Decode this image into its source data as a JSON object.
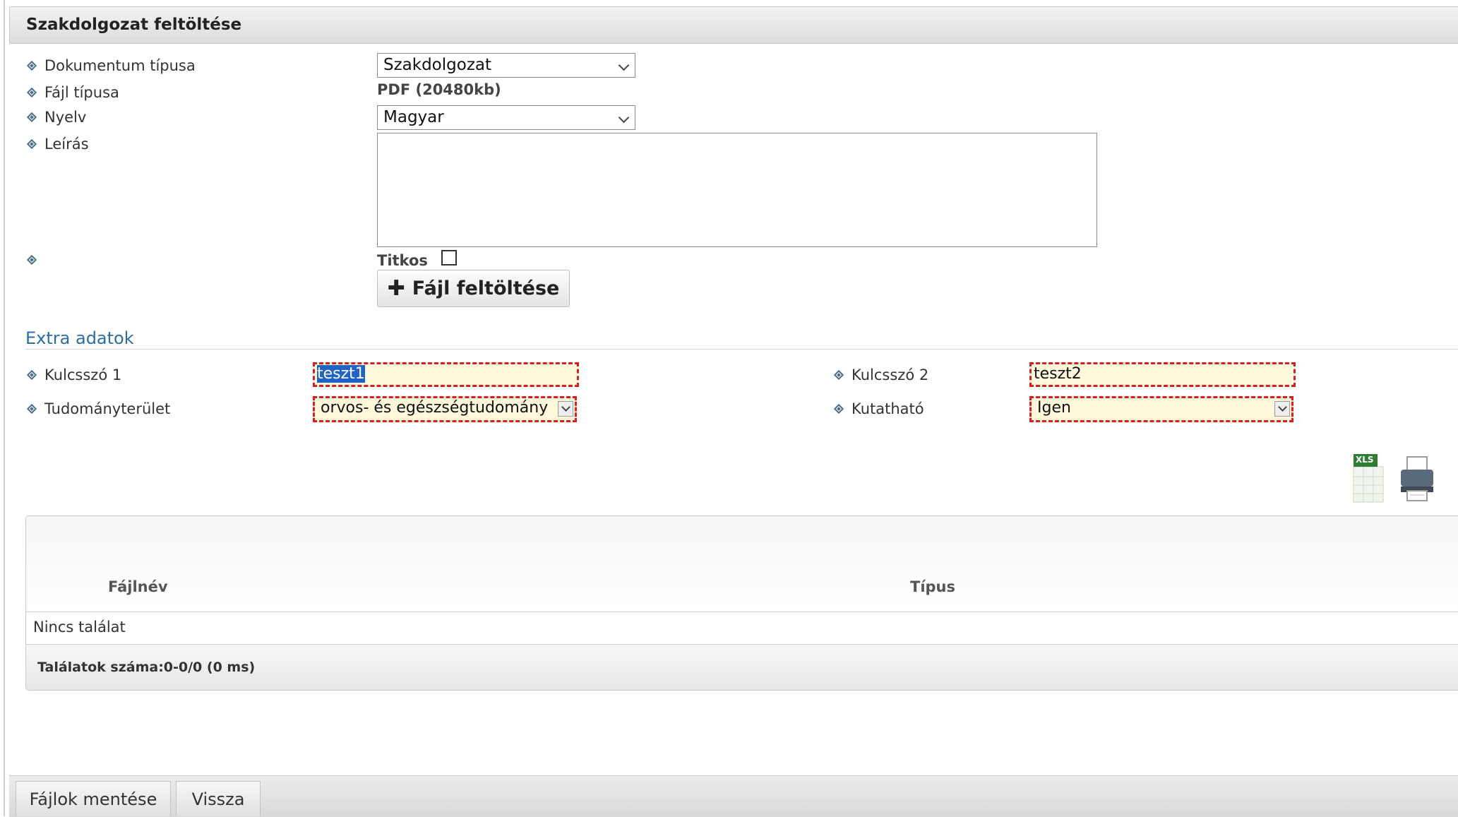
{
  "header": {
    "title": "Szakdolgozat feltöltése"
  },
  "form": {
    "doc_type_label": "Dokumentum típusa",
    "doc_type_value": "Szakdolgozat",
    "file_type_label": "Fájl típusa",
    "file_type_value": "PDF (20480kb)",
    "language_label": "Nyelv",
    "language_value": "Magyar",
    "description_label": "Leírás",
    "description_value": "",
    "secret_label": "Titkos",
    "upload_button_label": "Fájl feltöltése"
  },
  "extra": {
    "section_title": "Extra adatok",
    "keyword1_label": "Kulcsszó 1",
    "keyword1_value": "teszt1",
    "keyword2_label": "Kulcsszó 2",
    "keyword2_value": "teszt2",
    "field_label": "Tudományterület",
    "field_value": "orvos- és egészségtudomány",
    "researchable_label": "Kutatható",
    "researchable_value": "Igen"
  },
  "toolbar": {
    "xls_icon_text": "XLS"
  },
  "grid": {
    "columns": [
      "Fájlnév",
      "Típus"
    ],
    "empty_text": "Nincs találat",
    "footer_text": "Találatok száma:0-0/0 (0 ms)"
  },
  "footer": {
    "save_label": "Fájlok mentése",
    "back_label": "Vissza"
  },
  "colors": {
    "link_blue": "#2d6da3",
    "required_red": "#d42020",
    "required_bg": "#fdf8dc",
    "selection_blue": "#1f63c6"
  }
}
